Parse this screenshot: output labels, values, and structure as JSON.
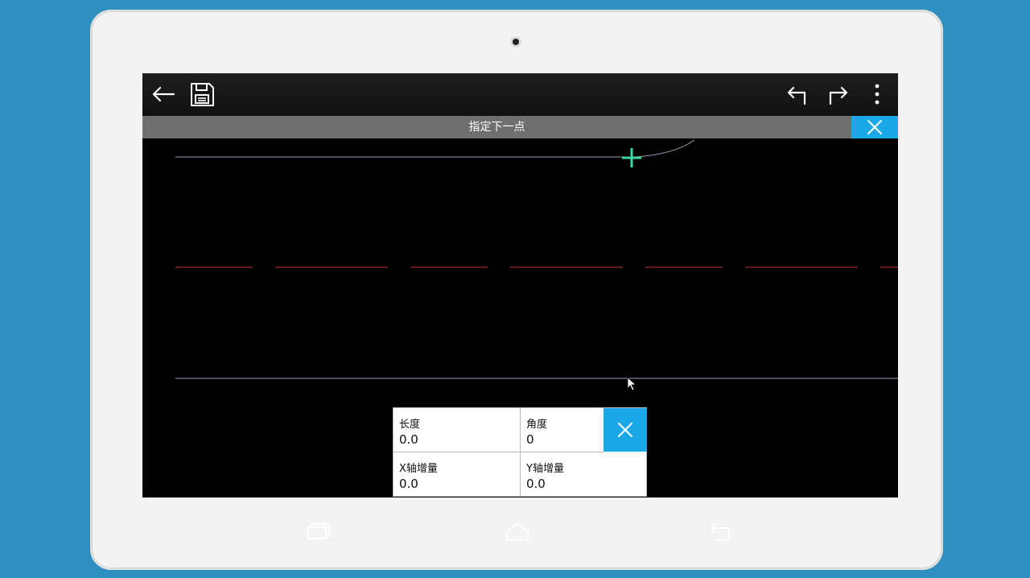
{
  "toolbar": {
    "back_icon": "arrow-left-icon",
    "save_icon": "floppy-disk-icon",
    "undo_icon": "undo-icon",
    "redo_icon": "redo-icon",
    "menu_icon": "more-vertical-icon"
  },
  "prompt": {
    "text": "指定下一点",
    "close_icon": "close-icon"
  },
  "input_panel": {
    "length_label": "长度",
    "length_value": "0.0",
    "angle_label": "角度",
    "angle_value": "0",
    "x_label": "X轴增量",
    "x_value": "0.0",
    "y_label": "Y轴增量",
    "y_value": "0.0",
    "close_icon": "close-icon"
  },
  "navbar": {
    "recent_icon": "recent-apps-icon",
    "home_icon": "home-icon",
    "back_icon": "back-icon"
  },
  "colors": {
    "accent": "#1aa8e8",
    "crosshair": "#3ed6a0",
    "dashed_line": "#c0392b",
    "toolbar_bg": "#111111",
    "prompt_bg": "#6f6f6f",
    "device_bg": "#2f8fbf"
  }
}
